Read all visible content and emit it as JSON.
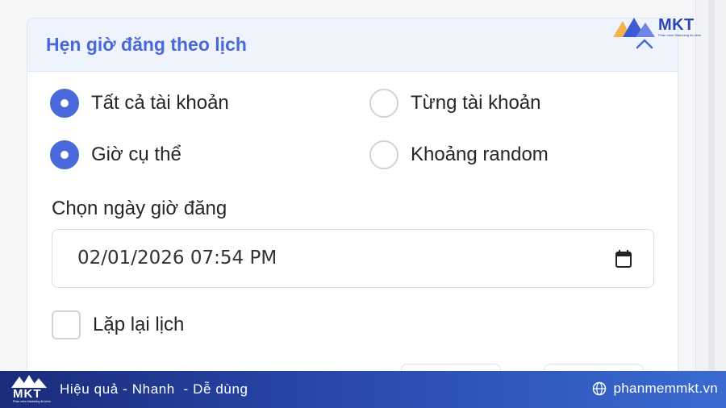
{
  "panel": {
    "title": "Hẹn giờ đăng theo lịch",
    "options": [
      {
        "label": "Tất cả tài khoản",
        "checked": true
      },
      {
        "label": "Từng tài khoản",
        "checked": false
      },
      {
        "label": "Giờ cụ thể",
        "checked": true
      },
      {
        "label": "Khoảng random",
        "checked": false
      }
    ],
    "datetime_label": "Chọn ngày giờ đăng",
    "datetime_value": "02/01/2026 07:54 PM",
    "repeat_label": "Lặp lại lịch",
    "repeat_checked": false
  },
  "brand": {
    "logo_text": "MKT",
    "logo_subtext": "Phần mềm Marketing đa kênh",
    "slogan": "Hiệu quả - Nhanh  - Dễ dùng",
    "website": "phanmemmkt.vn"
  },
  "colors": {
    "accent": "#4a69d8",
    "header_bg": "#eef3fc",
    "footer_start": "#1a2b7a",
    "footer_end": "#3a6ad0"
  }
}
